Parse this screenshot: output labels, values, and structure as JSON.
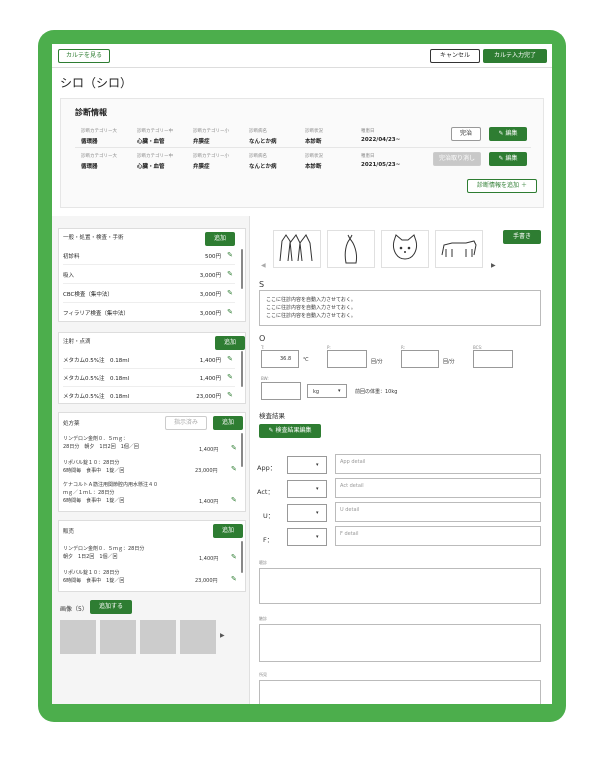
{
  "topbar": {
    "karte_label": "カルテを見る",
    "cancel_label": "キャンセル",
    "complete_label": "カルテ入力完了"
  },
  "patient": {
    "name": "シロ（シロ）"
  },
  "diagnosis": {
    "heading": "診断情報",
    "col_labels": [
      "診断カテゴリー大",
      "診断カテゴリー中",
      "診断カテゴリー小",
      "診断病名",
      "診断状況",
      "罹患日"
    ],
    "rows": [
      {
        "values": [
          "循環器",
          "心臓・血管",
          "弁膜症",
          "なんとか病",
          "本診断",
          "2022/04/23~"
        ],
        "status_button": "完治",
        "edit_label": "編集"
      },
      {
        "values": [
          "循環器",
          "心臓・血管",
          "弁膜症",
          "なんとか病",
          "本診断",
          "2021/05/23~"
        ],
        "status_button": "完治取り消し",
        "edit_label": "編集"
      }
    ],
    "add_label": "診断情報を追加 ＋"
  },
  "cards": {
    "procedures": {
      "title": "一般・処置・検査・手術",
      "add_label": "追加",
      "items": [
        {
          "name": "初診料",
          "price": "500円"
        },
        {
          "name": "吸入",
          "price": "3,000円"
        },
        {
          "name": "CBC検査（集中法）",
          "price": "3,000円"
        },
        {
          "name": "フィラリア検査（集中法）",
          "price": "3,000円"
        }
      ]
    },
    "injections": {
      "title": "注射・点滴",
      "add_label": "追加",
      "items": [
        {
          "name": "メタカム0.5%注　0.18ml",
          "price": "1,400円"
        },
        {
          "name": "メタカム0.5%注　0.18ml",
          "price": "1,400円"
        },
        {
          "name": "メタカム0.5%注　0.18ml",
          "price": "23,000円"
        }
      ]
    },
    "prescriptions": {
      "title": "処方薬",
      "issued_label": "指示済み",
      "add_label": "追加",
      "items": [
        {
          "line1": "リンデロン金剤０．５ｍｇ：",
          "line2": "28日分　朝夕　1日2回　1個／回",
          "price": "1,400円"
        },
        {
          "line1": "リポバル錠１０：28日分",
          "line2": "6時間毎　食事中　1錠／回",
          "price": "23,000円"
        },
        {
          "line1": "ケナコルトＡ筋注用関節腔内用水懸注４０",
          "line2": "ｍｇ／１ｍＬ：28日分",
          "line3": "6時間毎　食事中　1錠／回",
          "price": "1,400円"
        }
      ]
    },
    "sales": {
      "title": "販売",
      "add_label": "追加",
      "items": [
        {
          "line1": "リンデロン金剤０．５ｍｇ：28日分",
          "line2": "朝夕　1日2回　1個／回",
          "price": "1,400円"
        },
        {
          "line1": "リポバル錠１０：28日分",
          "line2": "6時間毎　食事中　1錠／回",
          "price": "23,000円"
        }
      ]
    }
  },
  "images": {
    "label": "画像（5）",
    "add_label": "追加する",
    "next_icon": "▶"
  },
  "soap": {
    "handwriting_label": "手書き",
    "prev_icon": "◀",
    "next_icon": "▶",
    "s_label": "S",
    "s_text": [
      "ここに往診内容を自動入力させておく。",
      "ここに往診内容を自動入力させておく。",
      "ここに往診内容を自動入力させておく。"
    ],
    "o_label": "O",
    "vitals": {
      "t_label": "T:",
      "t_value": "36.8",
      "t_unit": "℃",
      "p_label": "P:",
      "p_unit": "回/分",
      "r_label": "R:",
      "r_unit": "回/分",
      "bcs_label": "BCS:",
      "bw_label": "BW:",
      "bw_unit": "kg",
      "prev_weight": "前回の体重：10kg"
    },
    "exam_label": "検査結果",
    "exam_edit_label": "検査結果編集",
    "apfu": [
      {
        "label": "App：",
        "placeholder": "App detail"
      },
      {
        "label": "Act：",
        "placeholder": "Act detail"
      },
      {
        "label": "U：",
        "placeholder": "U detail"
      },
      {
        "label": "F：",
        "placeholder": "F detail"
      }
    ],
    "notes": [
      "聴診",
      "触診",
      "所見"
    ]
  },
  "colors": {
    "accent": "#2e7d32",
    "frame": "#4cae4c"
  }
}
